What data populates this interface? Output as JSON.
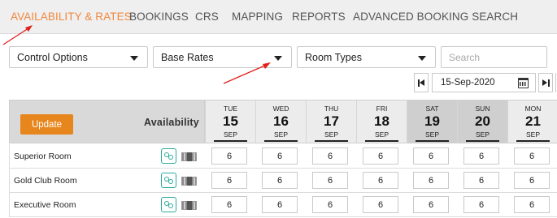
{
  "nav": {
    "tabs": [
      {
        "label": "AVAILABILITY & RATES",
        "active": true
      },
      {
        "label": "BOOKINGS"
      },
      {
        "label": "CRS"
      },
      {
        "label": "MAPPING"
      },
      {
        "label": "REPORTS"
      },
      {
        "label": "ADVANCED BOOKING SEARCH"
      }
    ]
  },
  "filters": {
    "control_options": "Control Options",
    "base_rates": "Base Rates",
    "room_types": "Room Types",
    "search_placeholder": "Search"
  },
  "date_nav": {
    "current_date": "15-Sep-2020",
    "icons": [
      "first-page-icon",
      "calendar-icon",
      "last-page-icon"
    ]
  },
  "grid": {
    "update_label": "Update",
    "availability_label": "Availability",
    "prev_caret": "‹",
    "days": [
      {
        "dow": "TUE",
        "num": "15",
        "mon": "SEP",
        "weekend": false
      },
      {
        "dow": "WED",
        "num": "16",
        "mon": "SEP",
        "weekend": false
      },
      {
        "dow": "THU",
        "num": "17",
        "mon": "SEP",
        "weekend": false
      },
      {
        "dow": "FRI",
        "num": "18",
        "mon": "SEP",
        "weekend": false
      },
      {
        "dow": "SAT",
        "num": "19",
        "mon": "SEP",
        "weekend": true
      },
      {
        "dow": "SUN",
        "num": "20",
        "mon": "SEP",
        "weekend": true
      },
      {
        "dow": "MON",
        "num": "21",
        "mon": "SEP",
        "weekend": false
      }
    ],
    "rows": [
      {
        "name": "Superior Room",
        "values": [
          "6",
          "6",
          "6",
          "6",
          "6",
          "6",
          "6"
        ]
      },
      {
        "name": "Gold Club Room",
        "values": [
          "6",
          "6",
          "6",
          "6",
          "6",
          "6",
          "6"
        ]
      },
      {
        "name": "Executive Room",
        "values": [
          "6",
          "6",
          "6",
          "6",
          "6",
          "6",
          "6"
        ]
      }
    ]
  },
  "colors": {
    "accent": "#f0883e",
    "update_button": "#e8861e",
    "link_icon": "#2aa99b",
    "annotation_arrow": "#e0201b"
  }
}
